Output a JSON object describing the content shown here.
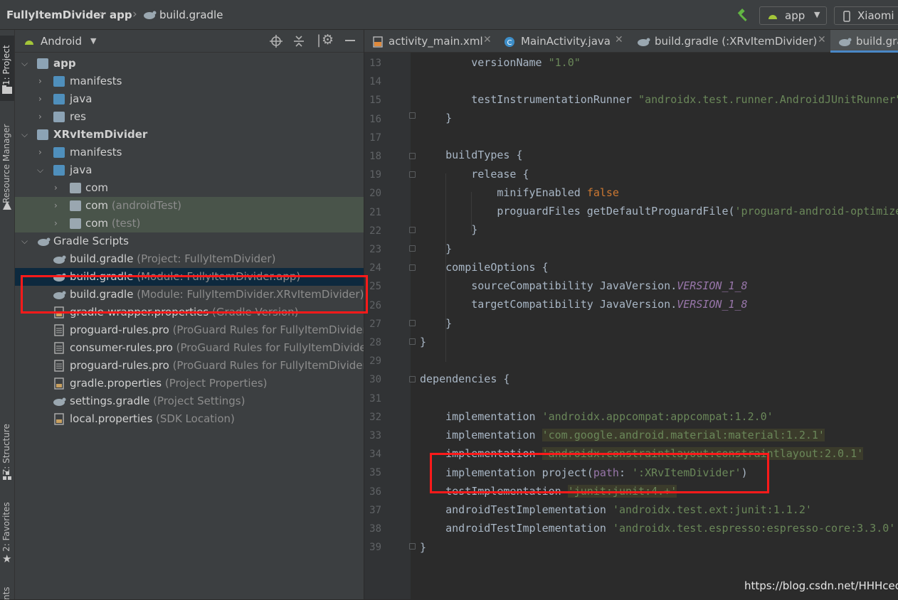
{
  "breadcrumb": {
    "project": "FullyItemDivider",
    "module": "app",
    "file": "build.gradle"
  },
  "toolbar": {
    "run_config": "app",
    "device": "Xiaomi"
  },
  "left_stripe": {
    "project_tab": "1: Project",
    "resource_manager_tab": "Resource Manager",
    "structure_tab": "Z: Structure",
    "favorites_tab": "2: Favorites",
    "bottom_tab": "nts"
  },
  "project_panel": {
    "view_mode": "Android",
    "tree": [
      {
        "label": "app",
        "suffix": "",
        "bold": true
      },
      {
        "label": "manifests",
        "suffix": ""
      },
      {
        "label": "java",
        "suffix": ""
      },
      {
        "label": "res",
        "suffix": ""
      },
      {
        "label": "XRvItemDivider",
        "suffix": "",
        "bold": true
      },
      {
        "label": "manifests",
        "suffix": ""
      },
      {
        "label": "java",
        "suffix": ""
      },
      {
        "label": "com",
        "suffix": ""
      },
      {
        "label": "com",
        "suffix": " (androidTest)"
      },
      {
        "label": "com",
        "suffix": " (test)"
      },
      {
        "label": "Gradle Scripts",
        "suffix": ""
      },
      {
        "label": "build.gradle",
        "suffix": " (Project: FullyItemDivider)"
      },
      {
        "label": "build.gradle",
        "suffix": " (Module: FullyItemDivider.app)"
      },
      {
        "label": "build.gradle",
        "suffix": " (Module: FullyItemDivider.XRvItemDivider)"
      },
      {
        "label": "gradle-wrapper.properties",
        "suffix": " (Gradle Version)"
      },
      {
        "label": "proguard-rules.pro",
        "suffix": " (ProGuard Rules for FullyItemDivider."
      },
      {
        "label": "consumer-rules.pro",
        "suffix": " (ProGuard Rules for FullyItemDivider"
      },
      {
        "label": "proguard-rules.pro",
        "suffix": " (ProGuard Rules for FullyItemDivider."
      },
      {
        "label": "gradle.properties",
        "suffix": " (Project Properties)"
      },
      {
        "label": "settings.gradle",
        "suffix": " (Project Settings)"
      },
      {
        "label": "local.properties",
        "suffix": " (SDK Location)"
      }
    ]
  },
  "tabs": [
    {
      "label": "activity_main.xml"
    },
    {
      "label": "MainActivity.java"
    },
    {
      "label": "build.gradle (:XRvItemDivider)"
    },
    {
      "label": "build.gra"
    }
  ],
  "editor": {
    "line_numbers": [
      "13",
      "14",
      "15",
      "16",
      "17",
      "18",
      "19",
      "20",
      "21",
      "22",
      "23",
      "24",
      "25",
      "26",
      "27",
      "28",
      "29",
      "30",
      "31",
      "32",
      "33",
      "34",
      "35",
      "36",
      "37",
      "38",
      "39"
    ],
    "code": {
      "l13_a": "        versionName ",
      "l13_b": "\"1.0\"",
      "l15_a": "        testInstrumentationRunner ",
      "l15_b": "\"androidx.test.runner.AndroidJUnitRunner\"",
      "l16": "    }",
      "l18": "    buildTypes {",
      "l19": "        release {",
      "l20_a": "            minifyEnabled ",
      "l20_b": "false",
      "l21_a": "            proguardFiles getDefaultProguardFile(",
      "l21_b": "'proguard-android-optimize",
      "l22": "        }",
      "l23": "    }",
      "l24": "    compileOptions {",
      "l25_a": "        sourceCompatibility JavaVersion.",
      "l25_b": "VERSION_1_8",
      "l26_a": "        targetCompatibility JavaVersion.",
      "l26_b": "VERSION_1_8",
      "l27": "    }",
      "l28": "}",
      "l30": "dependencies {",
      "l32_a": "    implementation ",
      "l32_b": "'androidx.appcompat:appcompat:1.2.0'",
      "l33_a": "    implementation ",
      "l33_b": "'com.google.android.material:material:1.2.1'",
      "l34_a": "    implementation ",
      "l34_b": "'androidx.constraintlayout:constraintlayout:2.0.1'",
      "l35_a": "    implementation project(",
      "l35_b": "path",
      "l35_c": ": ",
      "l35_d": "':XRvItemDivider'",
      "l35_e": ")",
      "l36_a": "    testImplementation ",
      "l36_b": "'junit:junit:4.+'",
      "l37_a": "    androidTestImplementation ",
      "l37_b": "'androidx.test.ext:junit:1.1.2'",
      "l38_a": "    androidTestImplementation ",
      "l38_b": "'androidx.test.espresso:espresso-core:3.3.0'",
      "l39": "}"
    }
  },
  "watermark": "https://blog.csdn.net/HHHceo",
  "colors": {
    "highlight_box": "#ff1a1a",
    "string": "#6a8759",
    "keyword": "#cc7832",
    "constant": "#9876aa"
  }
}
